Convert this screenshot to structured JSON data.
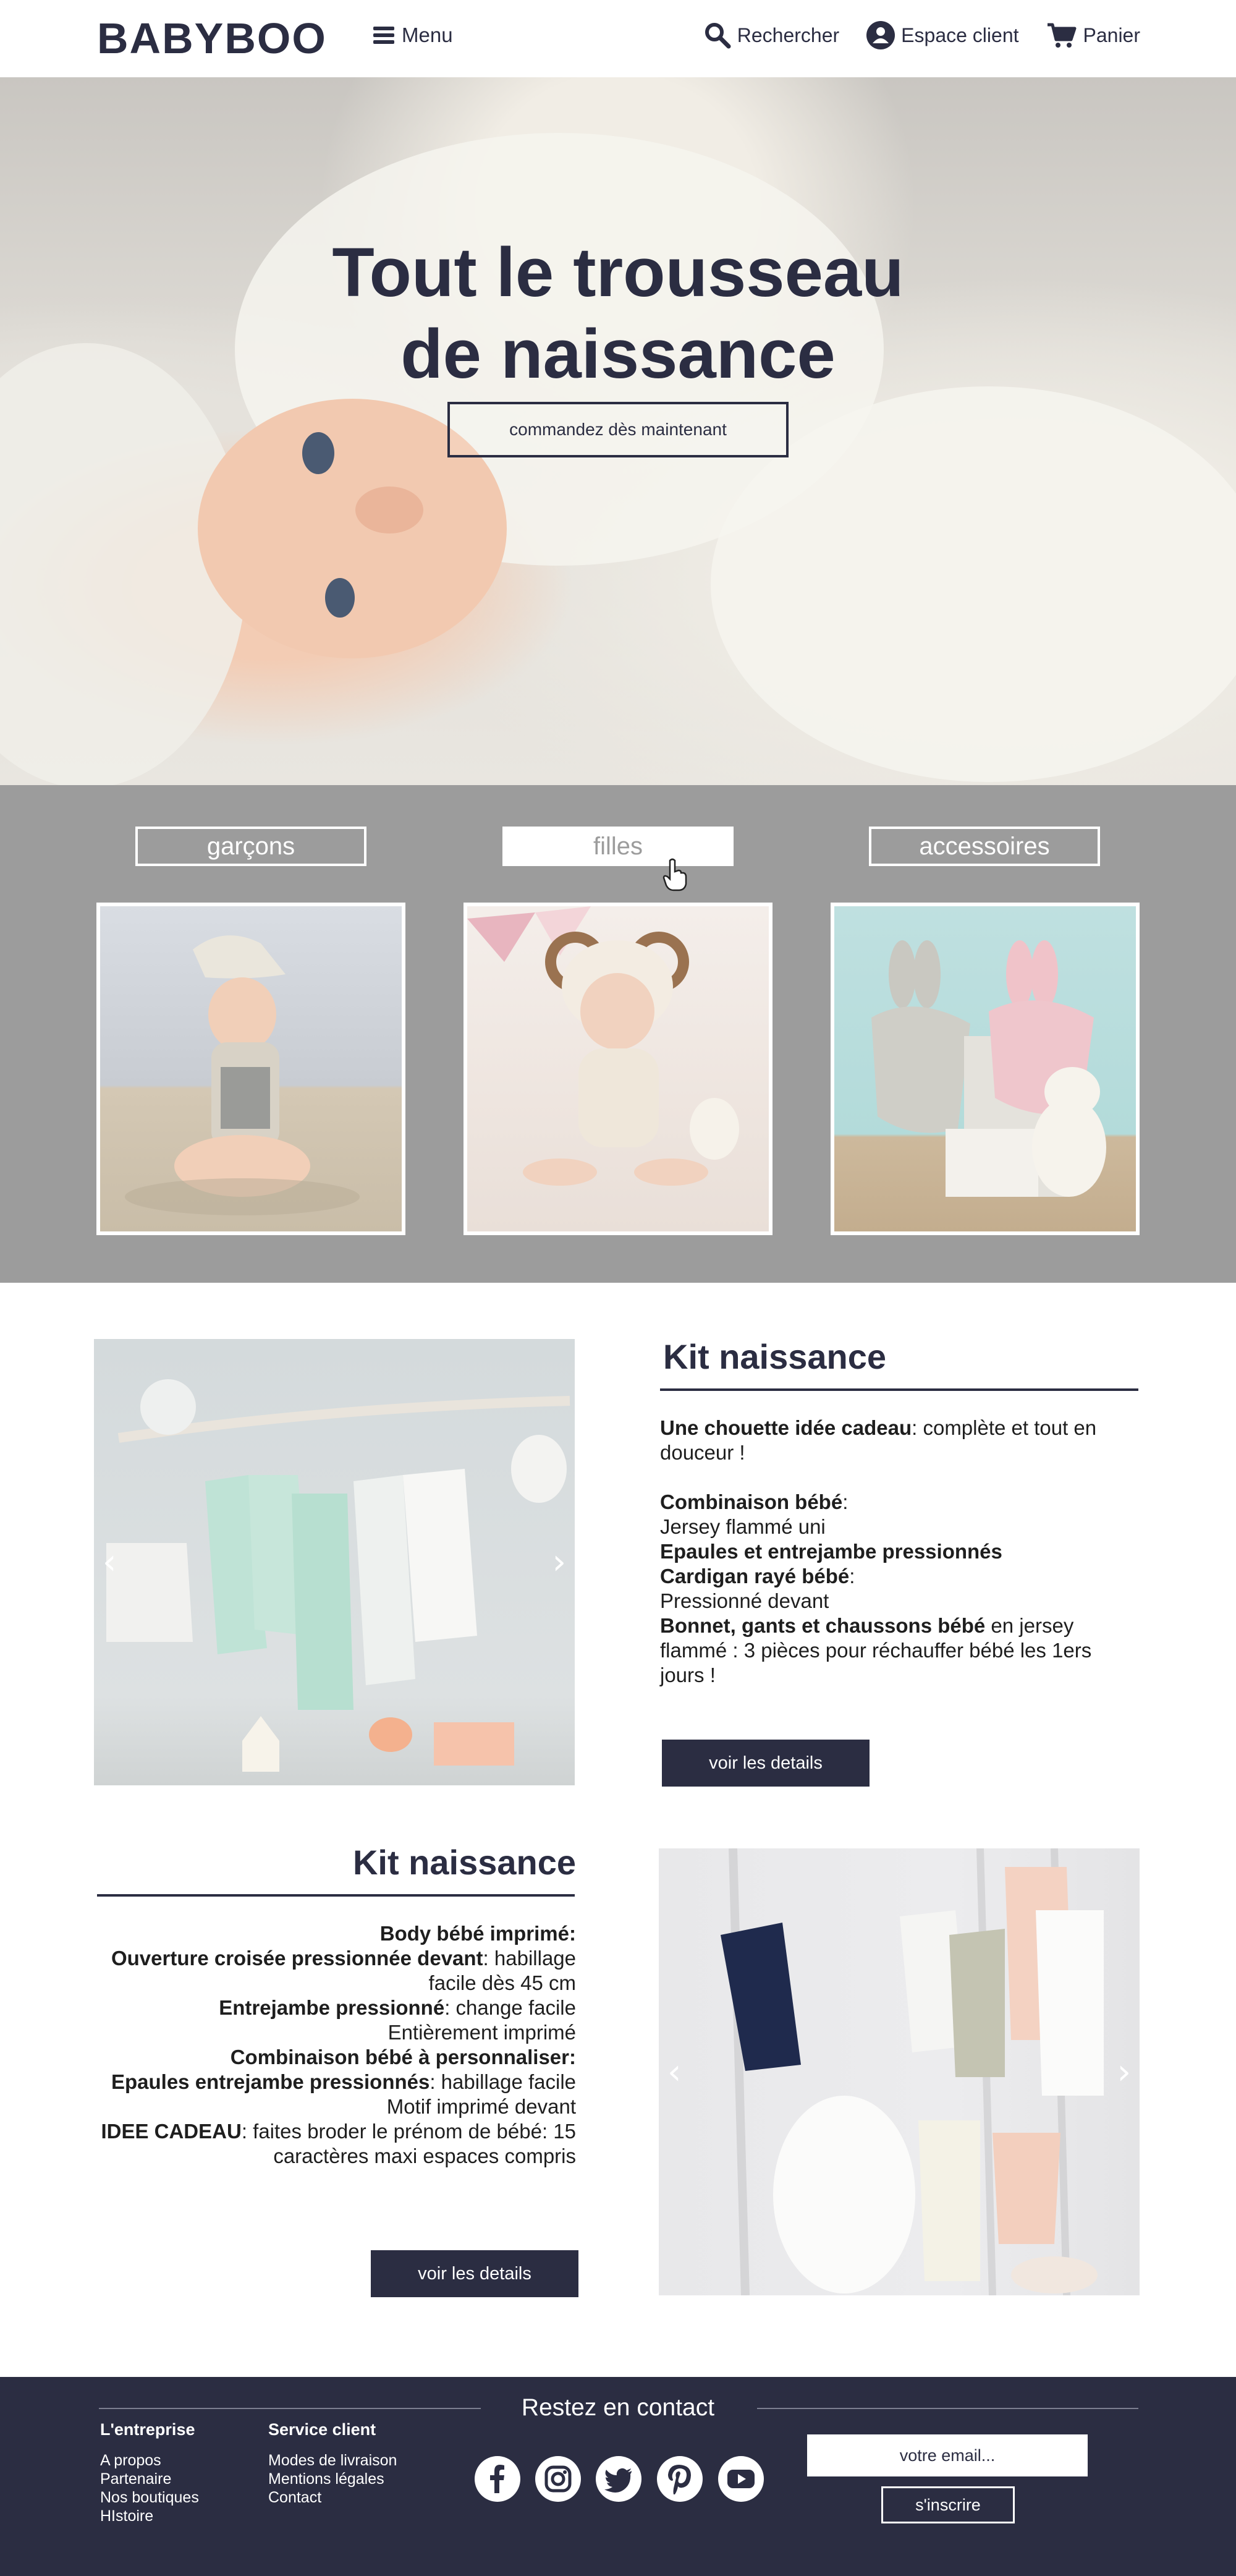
{
  "header": {
    "logo": "BABYBOO",
    "menu_label": "Menu",
    "search_label": "Rechercher",
    "account_label": "Espace client",
    "cart_label": "Panier"
  },
  "hero": {
    "title_line1": "Tout le trousseau",
    "title_line2": "de naissance",
    "cta_label": "commandez dès maintenant"
  },
  "categories": {
    "tabs": [
      {
        "label": "garçons",
        "active": false
      },
      {
        "label": "filles",
        "active": true
      },
      {
        "label": "accessoires",
        "active": false
      }
    ]
  },
  "kit1": {
    "title": "Kit naissance",
    "p1_bold": "Une chouette idée cadeau",
    "p1_rest": ": complète et tout en douceur !",
    "l1_bold": "Combinaison bébé",
    "l1_rest": ":",
    "l2": "Jersey flammé uni",
    "l3_bold": "Epaules et entrejambe pressionnés",
    "l4_bold": "Cardigan rayé bébé",
    "l4_rest": ":",
    "l5": "Pressionné devant",
    "l6_bold": "Bonnet, gants et chaussons bébé",
    "l6_rest": " en jersey flammé : 3 pièces pour réchauffer bébé les 1ers jours !",
    "button": "voir les details"
  },
  "kit2": {
    "title": "Kit naissance",
    "l1_bold": "Body bébé imprimé:",
    "l2_bold": "Ouverture croisée pressionnée devant",
    "l2_rest": ": habillage facile dès 45 cm",
    "l3_bold": "Entrejambe pressionné",
    "l3_rest": ": change facile",
    "l4": "Entièrement imprimé",
    "l5_bold": "Combinaison bébé à personnaliser:",
    "l6_bold": "Epaules entrejambe pressionnés",
    "l6_rest": ": habillage facile",
    "l7": "Motif imprimé devant",
    "l8_bold": "IDEE CADEAU",
    "l8_rest": ": faites broder le prénom de bébé: 15 caractères maxi espaces compris",
    "button": "voir les details"
  },
  "footer": {
    "company_title": "L'entreprise",
    "company_links": [
      "A propos",
      "Partenaire",
      "Nos boutiques",
      "HIstoire"
    ],
    "service_title": "Service client",
    "service_links": [
      "Modes de livraison",
      "Mentions légales",
      "Contact"
    ],
    "contact_title": "Restez en contact",
    "email_placeholder": "votre email...",
    "subscribe_label": "s'inscrire",
    "social_icons": [
      "facebook-icon",
      "instagram-icon",
      "twitter-icon",
      "pinterest-icon",
      "youtube-icon"
    ]
  },
  "colors": {
    "navy": "#2b2d42",
    "category_gray": "#9c9c9c",
    "white": "#ffffff"
  }
}
